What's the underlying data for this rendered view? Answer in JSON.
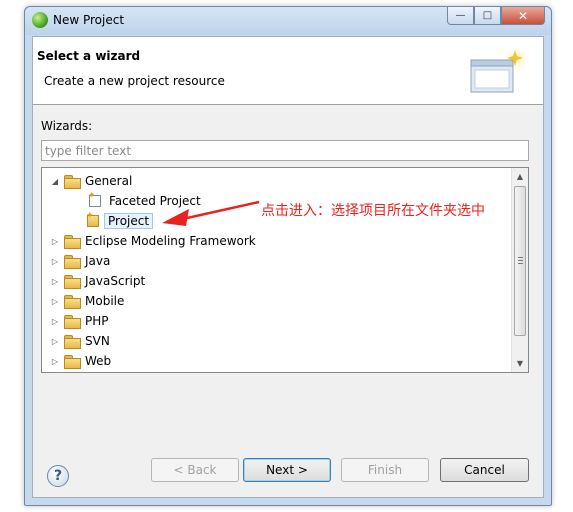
{
  "window": {
    "title": "New Project",
    "controls": {
      "minimize": "—",
      "maximize": "□",
      "close": "✕"
    }
  },
  "banner": {
    "title": "Select a wizard",
    "description": "Create a new project resource"
  },
  "wizards": {
    "label": "Wizards:",
    "filter_placeholder": "type filter text",
    "filter_value": "",
    "tree": [
      {
        "label": "General",
        "expanded": true,
        "level": 0
      },
      {
        "label": "Faceted Project",
        "level": 1
      },
      {
        "label": "Project",
        "level": 1,
        "selected": true
      },
      {
        "label": "Eclipse Modeling Framework",
        "expanded": false,
        "level": 0
      },
      {
        "label": "Java",
        "expanded": false,
        "level": 0
      },
      {
        "label": "JavaScript",
        "expanded": false,
        "level": 0
      },
      {
        "label": "Mobile",
        "expanded": false,
        "level": 0
      },
      {
        "label": "PHP",
        "expanded": false,
        "level": 0
      },
      {
        "label": "SVN",
        "expanded": false,
        "level": 0
      },
      {
        "label": "Web",
        "expanded": false,
        "level": 0
      }
    ]
  },
  "annotation": {
    "text": "点击进入：选择项目所在文件夹选中",
    "color": "#e8231f"
  },
  "buttons": {
    "help": "?",
    "back": "< Back",
    "next": "Next >",
    "finish": "Finish",
    "cancel": "Cancel"
  },
  "colors": {
    "accent": "#3c7fb1",
    "selection": "#e5f1fb"
  }
}
